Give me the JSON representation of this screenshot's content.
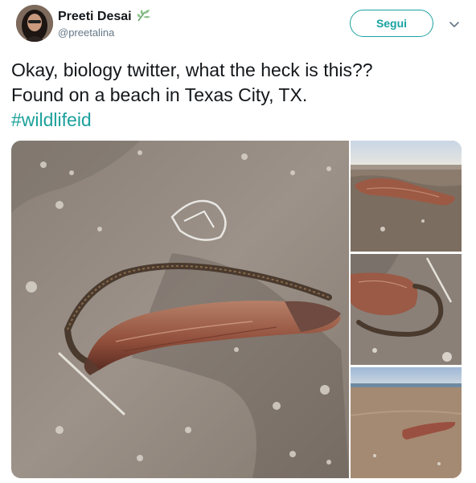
{
  "user": {
    "display_name": "Preeti Desai",
    "handle": "@preetalina",
    "verified_icon": "plant-sprout-icon"
  },
  "actions": {
    "follow_label": "Segui",
    "menu_icon": "chevron-down-icon"
  },
  "tweet": {
    "line1": "Okay, biology twitter, what the heck is this??",
    "line2": "Found on a beach in Texas City, TX.",
    "hashtag": "#wildlifeid"
  },
  "media": {
    "image_count": 4,
    "accent_color": "#1da19c"
  }
}
